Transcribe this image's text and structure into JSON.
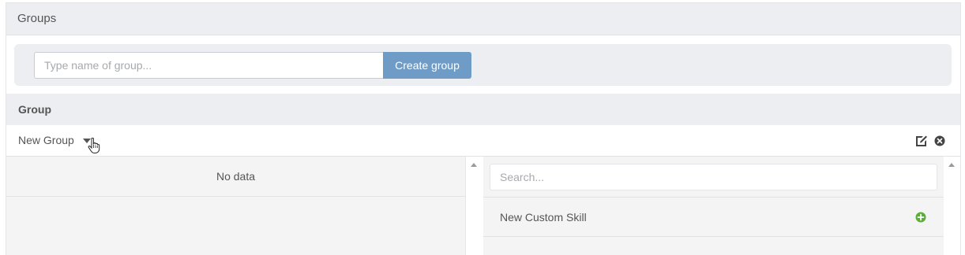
{
  "panel": {
    "title": "Groups"
  },
  "create": {
    "placeholder": "Type name of group...",
    "button_label": "Create group"
  },
  "groups_table": {
    "header": "Group",
    "rows": [
      {
        "name": "New Group"
      }
    ]
  },
  "members": {
    "empty_text": "No data"
  },
  "skills": {
    "search_placeholder": "Search...",
    "items": [
      {
        "label": "New Custom Skill"
      }
    ]
  },
  "colors": {
    "primary_button": "#6f9bc7",
    "add_icon": "#5cae3a",
    "header_bg": "#eceef1"
  },
  "icons": {
    "edit": "edit-icon",
    "delete": "close-circle-icon",
    "add": "plus-circle-icon",
    "dropdown": "caret-down-icon",
    "cursor": "hand-pointer-cursor"
  }
}
